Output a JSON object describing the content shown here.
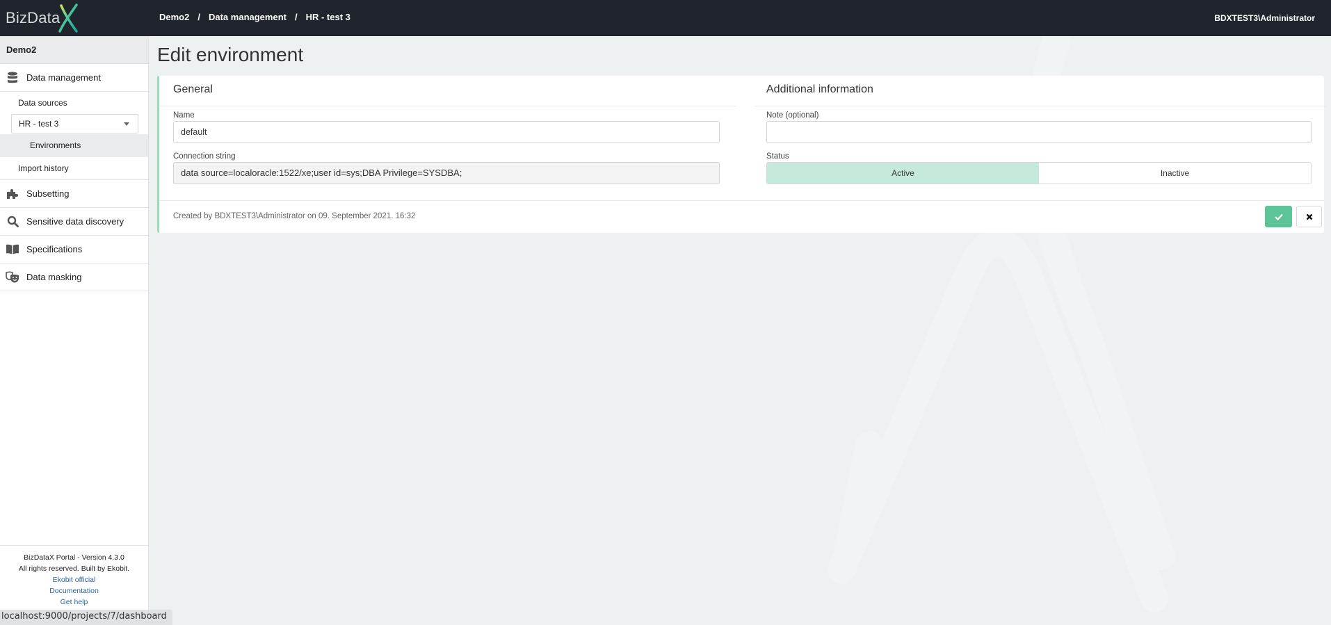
{
  "app": {
    "logo_text": "BizData",
    "user": "BDXTEST3\\Administrator",
    "colors": {
      "topbar": "#20242d",
      "accent_green": "#5dc497",
      "active_toggle": "#c5eadb",
      "card_border": "#9fd9bd",
      "link": "#2a6496"
    }
  },
  "breadcrumb": [
    {
      "label": "Demo2"
    },
    {
      "label": "Data management"
    },
    {
      "label": "HR - test 3"
    }
  ],
  "breadcrumb_separator": "/",
  "sidebar": {
    "project": "Demo2",
    "items": [
      {
        "label": "Data management",
        "icon": "database-icon"
      },
      {
        "label": "Subsetting",
        "icon": "puzzle-icon"
      },
      {
        "label": "Sensitive data discovery",
        "icon": "search-icon"
      },
      {
        "label": "Specifications",
        "icon": "book-icon"
      },
      {
        "label": "Data masking",
        "icon": "masks-icon"
      }
    ],
    "data_sources_label": "Data sources",
    "data_source_selected": "HR - test 3",
    "environments_label": "Environments",
    "import_history_label": "Import history",
    "footer": {
      "version": "BizDataX Portal - Version 4.3.0",
      "rights": "All rights reserved. Built by Ekobit.",
      "links": [
        "Ekobit official",
        "Documentation",
        "Get help"
      ]
    }
  },
  "page": {
    "title": "Edit environment",
    "general": {
      "heading": "General",
      "name_label": "Name",
      "name_value": "default",
      "connection_label": "Connection string",
      "connection_value": "data source=localoracle:1522/xe;user id=sys;DBA Privilege=SYSDBA;"
    },
    "additional": {
      "heading": "Additional information",
      "note_label": "Note (optional)",
      "note_value": "",
      "status_label": "Status",
      "status_options": [
        "Active",
        "Inactive"
      ],
      "status_selected": "Active"
    },
    "created_text": "Created by BDXTEST3\\Administrator on 09. September 2021. 16:32",
    "save_icon": "check-icon",
    "cancel_icon": "close-icon"
  },
  "statusbar": {
    "url": "localhost:9000/projects/7/dashboard"
  }
}
